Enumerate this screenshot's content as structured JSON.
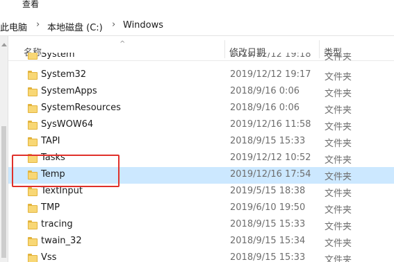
{
  "menu": {
    "view_label": "查看"
  },
  "breadcrumb": {
    "items": [
      "此电脑",
      "本地磁盘 (C:)",
      "Windows"
    ],
    "separator": "›"
  },
  "columns": {
    "name": "名称",
    "date": "修改日期",
    "type": "类型"
  },
  "rows": [
    {
      "name": "System",
      "date": "2019/12/12 19:18",
      "type": "文件夹",
      "selected": false
    },
    {
      "name": "System32",
      "date": "2019/12/12 19:17",
      "type": "文件夹",
      "selected": false
    },
    {
      "name": "SystemApps",
      "date": "2018/9/16 0:06",
      "type": "文件夹",
      "selected": false
    },
    {
      "name": "SystemResources",
      "date": "2018/9/16 0:06",
      "type": "文件夹",
      "selected": false
    },
    {
      "name": "SysWOW64",
      "date": "2019/12/16 11:58",
      "type": "文件夹",
      "selected": false
    },
    {
      "name": "TAPI",
      "date": "2018/9/15 15:33",
      "type": "文件夹",
      "selected": false
    },
    {
      "name": "Tasks",
      "date": "2019/12/12 10:52",
      "type": "文件夹",
      "selected": false
    },
    {
      "name": "Temp",
      "date": "2019/12/16 17:54",
      "type": "文件夹",
      "selected": true
    },
    {
      "name": "TextInput",
      "date": "2019/5/15 18:38",
      "type": "文件夹",
      "selected": false
    },
    {
      "name": "TMP",
      "date": "2019/6/10 19:50",
      "type": "文件夹",
      "selected": false
    },
    {
      "name": "tracing",
      "date": "2018/9/15 15:33",
      "type": "文件夹",
      "selected": false
    },
    {
      "name": "twain_32",
      "date": "2018/9/15 15:34",
      "type": "文件夹",
      "selected": false
    },
    {
      "name": "Vss",
      "date": "2018/9/15 15:33",
      "type": "文件夹",
      "selected": false
    }
  ],
  "colors": {
    "selection": "#cce8ff",
    "highlight_annotation": "#e0302a",
    "folder_fill": "#f8d775",
    "folder_edge": "#e2b33c"
  },
  "icons": {
    "folder": "folder-icon",
    "sort": "sort-up-icon"
  }
}
